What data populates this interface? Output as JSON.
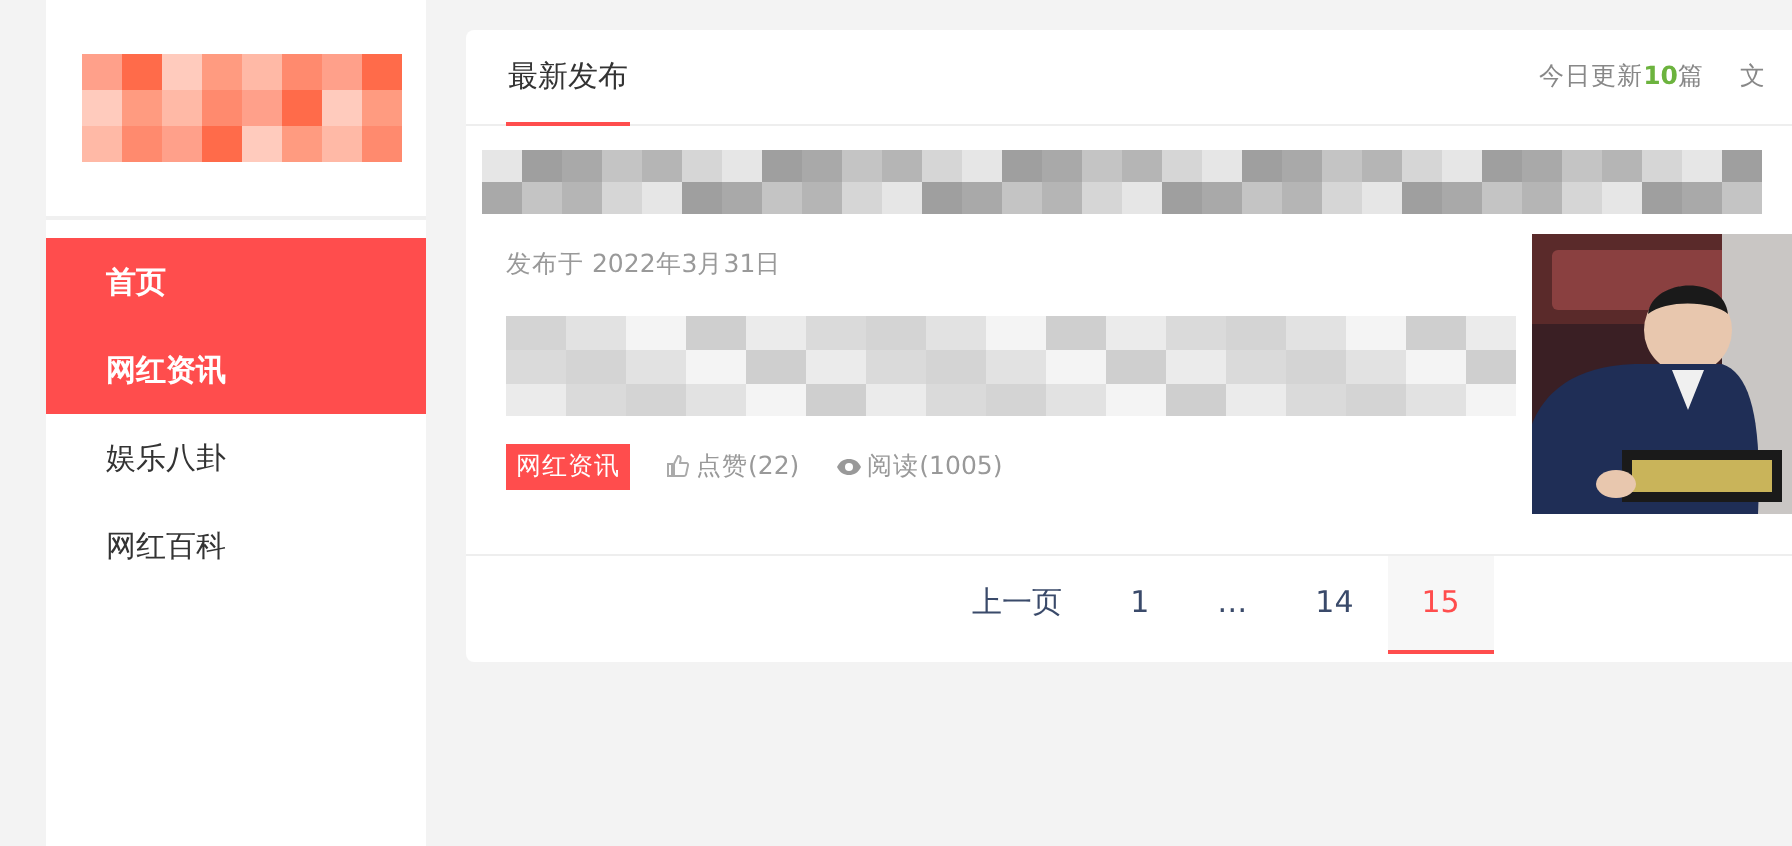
{
  "sidebar": {
    "items": [
      {
        "label": "首页",
        "selected": true
      },
      {
        "label": "网红资讯",
        "selected": true
      },
      {
        "label": "娱乐八卦",
        "selected": false
      },
      {
        "label": "网红百科",
        "selected": false
      }
    ]
  },
  "main": {
    "tabs": [
      {
        "label": "最新发布",
        "selected": true
      }
    ],
    "today": {
      "prefix": "今日更新",
      "count": "10",
      "suffix": "篇"
    },
    "header_cut": "文",
    "post": {
      "date": "发布于 2022年3月31日",
      "tag": "网红资讯",
      "likes": "点赞(22)",
      "views": "阅读(1005)"
    },
    "pagination": [
      {
        "label": "上一页",
        "selected": false
      },
      {
        "label": "1",
        "selected": false
      },
      {
        "label": "…",
        "selected": false
      },
      {
        "label": "14",
        "selected": false
      },
      {
        "label": "15",
        "selected": true
      }
    ]
  }
}
